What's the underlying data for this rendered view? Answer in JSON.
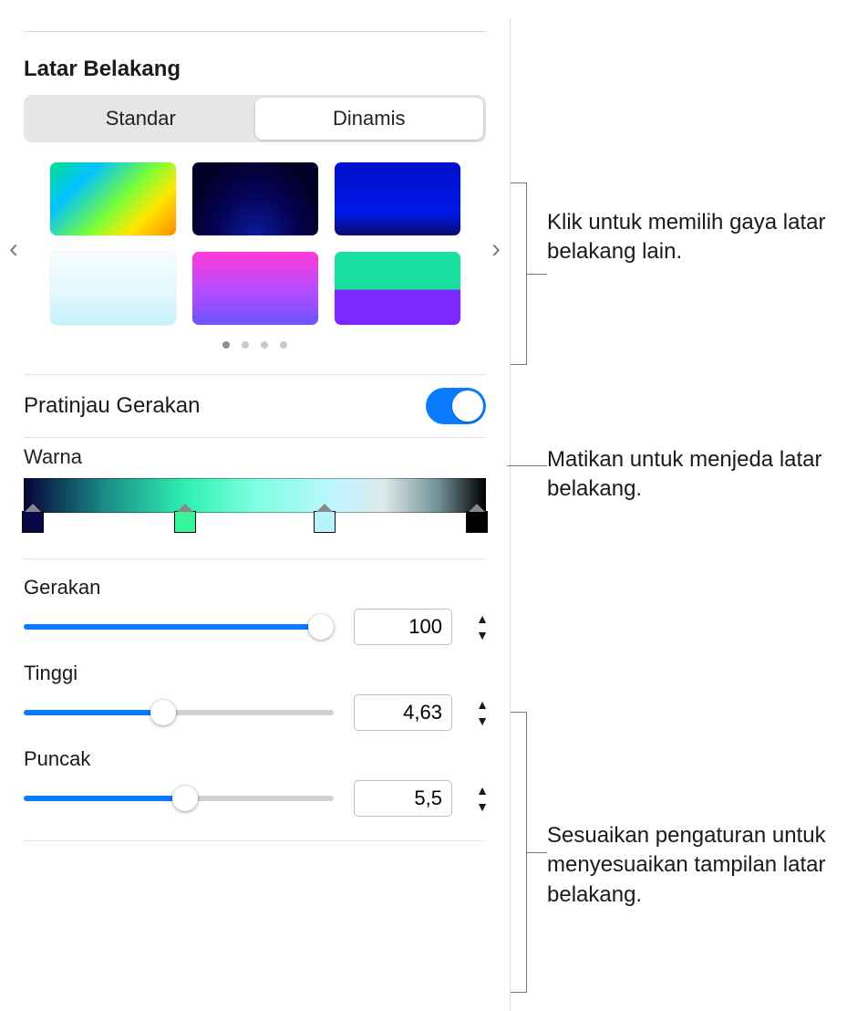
{
  "header": {
    "title": "Latar Belakang"
  },
  "segmented": {
    "standard": "Standar",
    "dynamic": "Dinamis",
    "active": "dynamic"
  },
  "motion_preview": {
    "label": "Pratinjau Gerakan",
    "on": true
  },
  "color": {
    "label": "Warna"
  },
  "sliders": {
    "gerakan": {
      "label": "Gerakan",
      "value": "100",
      "pct": 96
    },
    "tinggi": {
      "label": "Tinggi",
      "value": "4,63",
      "pct": 45
    },
    "puncak": {
      "label": "Puncak",
      "value": "5,5",
      "pct": 52
    }
  },
  "callouts": {
    "styles": "Klik untuk memilih gaya latar belakang lain.",
    "pause": "Matikan untuk menjeda latar belakang.",
    "adjust": "Sesuaikan pengaturan untuk menyesuaikan tampilan latar belakang."
  }
}
